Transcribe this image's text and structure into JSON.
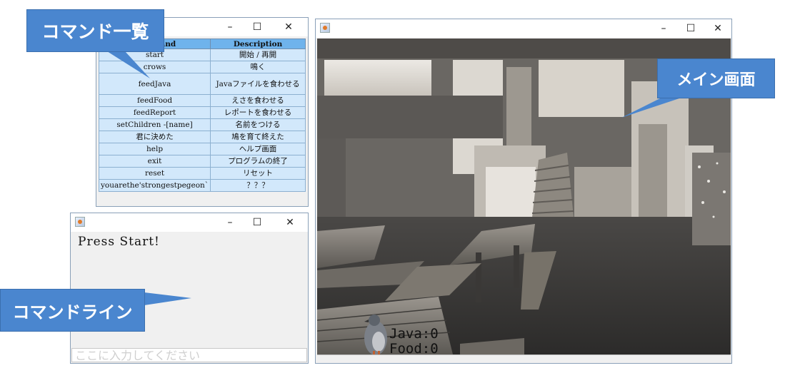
{
  "command_window": {
    "window_controls": {
      "minimize": "–",
      "maximize": "☐",
      "close": "✕"
    },
    "table": {
      "headers": [
        "Command",
        "Description"
      ],
      "rows": [
        {
          "command": "start",
          "description": "開始 / 再開"
        },
        {
          "command": "crows",
          "description": "鳴く"
        },
        {
          "command": "feedJava",
          "description": "Javaファイルを食わせる"
        },
        {
          "command": "feedFood",
          "description": "えさを食わせる"
        },
        {
          "command": "feedReport",
          "description": "レポートを食わせる"
        },
        {
          "command": "setChildren -[name]",
          "description": "名前をつける"
        },
        {
          "command": "君に決めた",
          "description": "鳩を育て終えた"
        },
        {
          "command": "help",
          "description": "ヘルプ画面"
        },
        {
          "command": "exit",
          "description": "プログラムの終了"
        },
        {
          "command": "reset",
          "description": "リセット"
        },
        {
          "command": "youarethe'strongestpegeon`",
          "description": "？？？"
        }
      ]
    }
  },
  "console_window": {
    "window_controls": {
      "minimize": "–",
      "maximize": "☐",
      "close": "✕"
    },
    "output": "Press Start!",
    "input": {
      "value": "",
      "placeholder": "ここに入力してください"
    }
  },
  "main_window": {
    "window_controls": {
      "minimize": "–",
      "maximize": "☐",
      "close": "✕"
    },
    "status": {
      "java": "Java:0",
      "food": "Food:0"
    }
  },
  "callouts": {
    "command_list": "コマンド一覧",
    "main_screen": "メイン画面",
    "command_line": "コマンドライン"
  },
  "colors": {
    "callout": "#4a86cf",
    "table_header": "#6fb3ec",
    "table_cell": "#d2e8fb"
  }
}
